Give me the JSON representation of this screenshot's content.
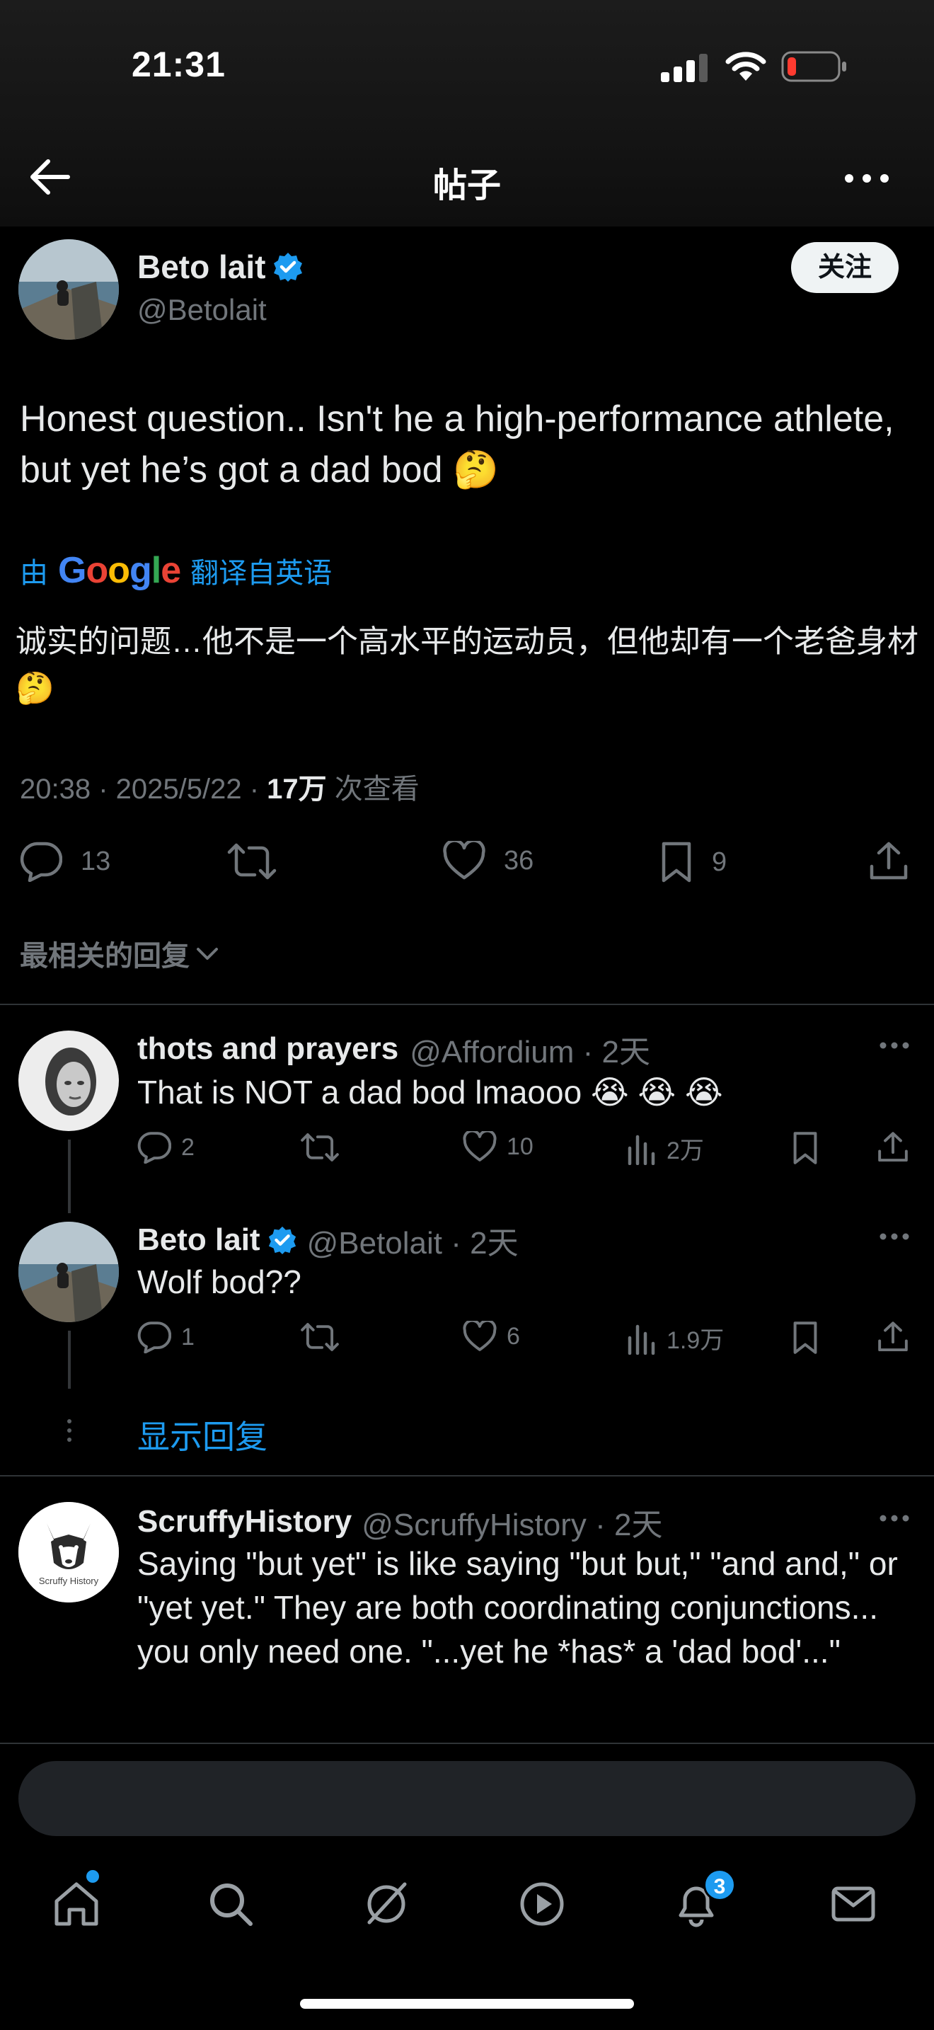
{
  "status_bar": {
    "time": "21:31"
  },
  "header": {
    "title": "帖子"
  },
  "main_tweet": {
    "display_name": "Beto lait",
    "handle": "@Betolait",
    "follow_label": "关注",
    "text": "Honest question.. Isn't he a high-performance athlete, but yet he’s got a dad bod 🤔",
    "translate_prefix": "由",
    "translate_brand": "Google",
    "translate_suffix": "翻译自英语",
    "translated_text": "诚实的问题…他不是一个高水平的运动员，但他却有一个老爸身材🤔",
    "timestamp": "20:38 · 2025/5/22 · ",
    "views_count": "17万",
    "views_label": " 次查看",
    "reply_count": "13",
    "like_count": "36",
    "bookmark_count": "9"
  },
  "sort_label": "最相关的回复",
  "replies": [
    {
      "display_name": "thots and prayers",
      "handle_time": "@Affordium · 2天",
      "text": "That is NOT a dad bod lmaooo 😭 😭 😭",
      "reply_count": "2",
      "like_count": "10",
      "view_count": "2万"
    },
    {
      "display_name": "Beto lait",
      "handle_time": "@Betolait · 2天",
      "text": "Wolf bod??",
      "reply_count": "1",
      "like_count": "6",
      "view_count": "1.9万"
    },
    {
      "display_name": "ScruffyHistory",
      "handle_time": "@ScruffyHistory · 2天",
      "text": "Saying \"but yet\" is like saying \"but but,\" \"and and,\" or \"yet yet.\" They are both coordinating conjunctions... you only need one. \"...yet he *has* a 'dad bod'...\"",
      "avatar_text": "Scruffy History"
    }
  ],
  "show_replies_label": "显示回复",
  "tabbar": {
    "notifications_badge": "3"
  },
  "colors": {
    "accent": "#1d9bf0",
    "muted": "#71767b",
    "background": "#000000"
  }
}
